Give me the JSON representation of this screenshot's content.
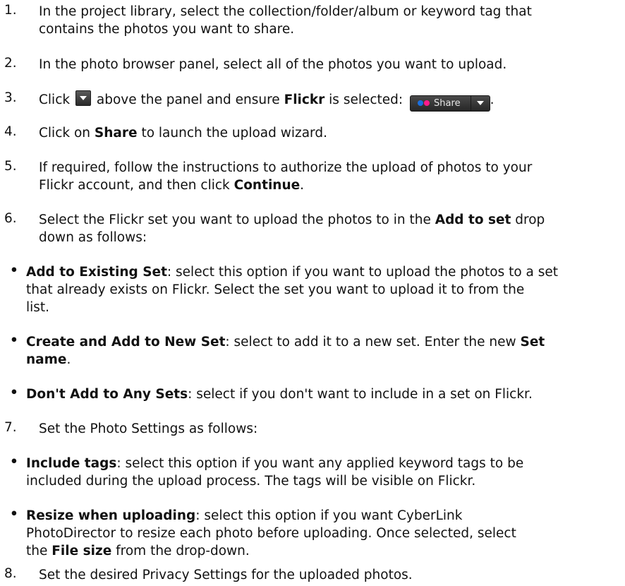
{
  "steps": [
    {
      "num": "1.",
      "lines": [
        "In the project library, select the collection/folder/album or keyword tag that",
        "contains the photos you want to share."
      ]
    },
    {
      "num": "2.",
      "text": "In the photo browser panel, select all of the photos you want to upload."
    },
    {
      "num": "3.",
      "t1": "Click",
      "t2": "above the panel and ensure",
      "b1": "Flickr",
      "t3": "is selected:",
      "share_label": "Share",
      "end": "."
    },
    {
      "num": "4.",
      "t1": "Click on",
      "b1": "Share",
      "t2": "to launch the upload wizard."
    },
    {
      "num": "5.",
      "line1": "If required, follow the instructions to authorize the upload of photos to your",
      "t1": "Flickr account, and then click",
      "b1": "Continue",
      "end": "."
    },
    {
      "num": "6.",
      "t1": "Select the Flickr set you want to upload the photos to in the",
      "b1": "Add to set",
      "t2": "drop",
      "line2": "down as follows:"
    },
    {
      "num": "7.",
      "text": "Set the Photo Settings as follows:"
    },
    {
      "num": "8.",
      "text": "Set the desired Privacy Settings for the uploaded photos."
    }
  ],
  "bullets": [
    {
      "term": "Add to Existing Set",
      "t1": ": select this option if you want to upload the photos to a set",
      "line2": "that already exists on Flickr. Select the set you want to upload it to from the",
      "line3": "list."
    },
    {
      "term": "Create and Add to New Set",
      "t1": ": select to add it to a new set. Enter the new",
      "b2": "Set",
      "b3": "name",
      "end": "."
    },
    {
      "term": "Don't Add to Any Sets",
      "t1": ": select if you don't want to include in a set on Flickr."
    },
    {
      "term": "Include tags",
      "t1": ": select this option if you want any applied keyword tags to be",
      "line2": "included during the upload process. The tags will be visible on Flickr."
    },
    {
      "term": "Resize when uploading",
      "t1": ": select this option if you want CyberLink",
      "line2": "PhotoDirector to resize each photo before uploading. Once selected, select",
      "t3": "the",
      "b3": "File size",
      "t4": "from the drop-down."
    }
  ]
}
